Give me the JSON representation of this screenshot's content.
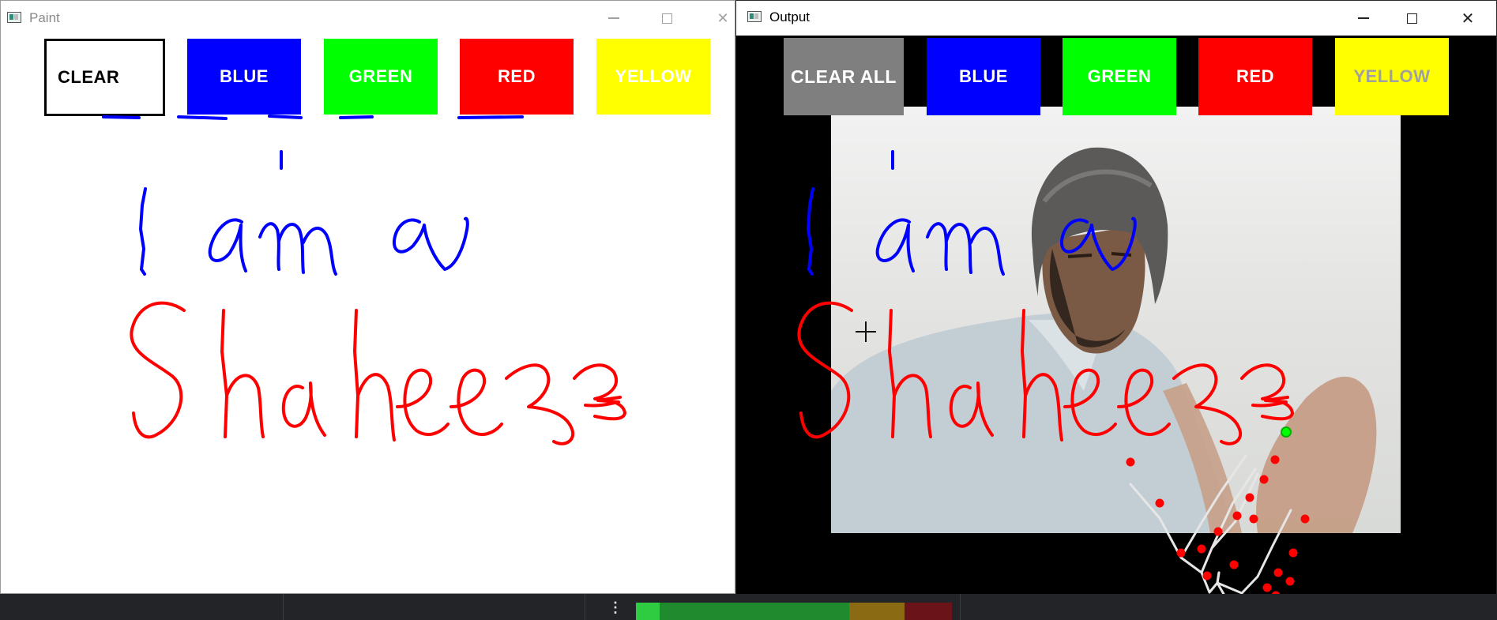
{
  "paint_window": {
    "title": "Paint",
    "icon": "opencv-window-icon",
    "buttons": [
      {
        "label": "CLEAR",
        "bg": "#ffffff",
        "fg": "#000000"
      },
      {
        "label": "BLUE",
        "bg": "#0000ff",
        "fg": "#ffffff"
      },
      {
        "label": "GREEN",
        "bg": "#00ff00",
        "fg": "#ffffff"
      },
      {
        "label": "RED",
        "bg": "#ff0000",
        "fg": "#ffffff"
      },
      {
        "label": "YELLOW",
        "bg": "#ffff00",
        "fg": "#ffffff"
      }
    ],
    "canvas_bg": "#ffffff"
  },
  "output_window": {
    "title": "Output",
    "icon": "opencv-window-icon",
    "buttons": [
      {
        "label": "CLEAR ALL",
        "bg": "#7f7f7f",
        "fg": "#ffffff"
      },
      {
        "label": "BLUE",
        "bg": "#0000ff",
        "fg": "#ffffff"
      },
      {
        "label": "GREEN",
        "bg": "#00ff00",
        "fg": "#ffffff"
      },
      {
        "label": "RED",
        "bg": "#ff0000",
        "fg": "#ffffff"
      },
      {
        "label": "YELLOW",
        "bg": "#ffff00",
        "fg": "#a0a0a0"
      }
    ],
    "frame_bg": "#000000",
    "landmark_color": "#ff0000",
    "index_tip_color": "#00ff00"
  },
  "stroke_colors": {
    "blue": "#0000ff",
    "red": "#ff0000"
  },
  "taskbar": {
    "bg": "#222428",
    "progress_colors": [
      "#2ecc40",
      "#1f8a2e",
      "#c89a1a",
      "#a01c24"
    ]
  }
}
